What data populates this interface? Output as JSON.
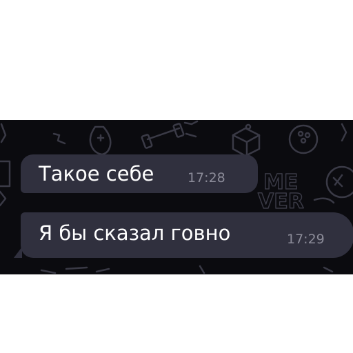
{
  "chat": {
    "messages": [
      {
        "text": "Такое себе",
        "time": "17:28"
      },
      {
        "text": "Я бы сказал говно",
        "time": "17:29"
      }
    ]
  },
  "wallpaper": {
    "sticker_text": [
      "ME",
      "VER"
    ]
  },
  "colors": {
    "page_background": "#ffffff",
    "chat_background": "#0b0b0f",
    "bubble": "#30303e",
    "message_text": "#ffffff",
    "timestamp_text": "#8b8b98",
    "doodle_stroke": "#3a3a46"
  },
  "icons": [
    "gamepad-icon",
    "dumbbell-icon",
    "dice-icon",
    "bowling-ball-icon",
    "controller-button-icon",
    "arrow-icon",
    "tv-icon"
  ]
}
